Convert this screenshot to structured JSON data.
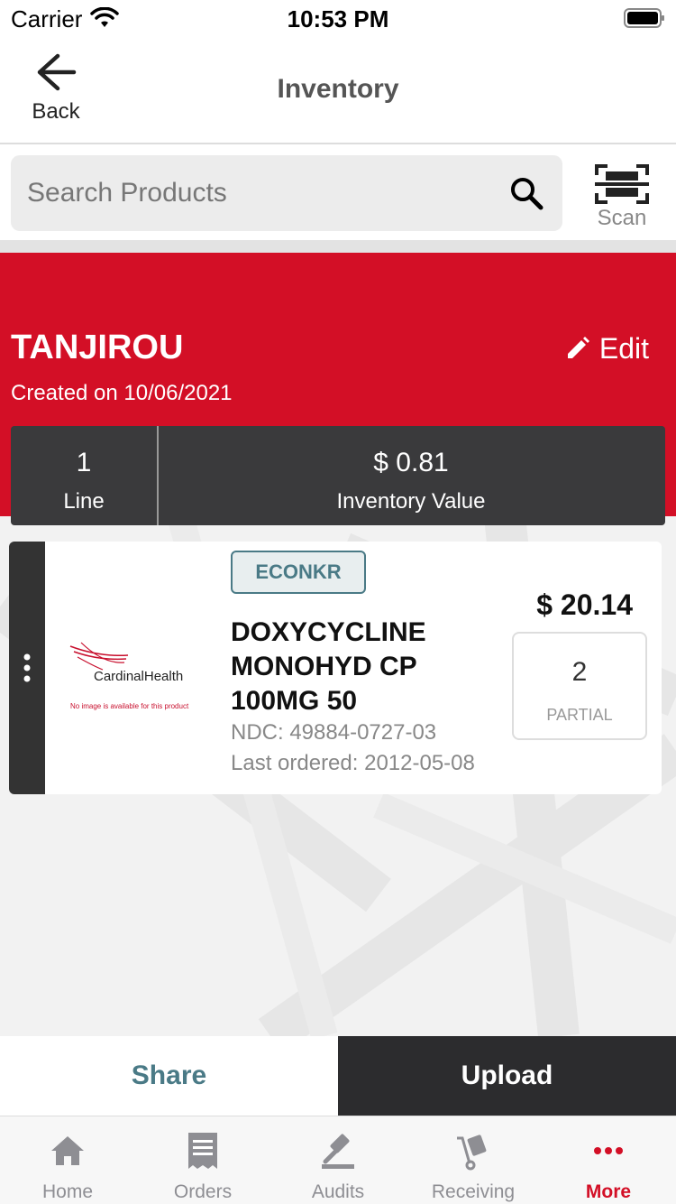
{
  "status_bar": {
    "carrier": "Carrier",
    "time": "10:53 PM"
  },
  "nav": {
    "back_label": "Back",
    "title": "Inventory"
  },
  "search": {
    "placeholder": "Search Products",
    "value": "",
    "scan_label": "Scan"
  },
  "inventory": {
    "name": "TANJIROU",
    "created": "Created on 10/06/2021",
    "edit_label": "Edit",
    "line_count": "1",
    "line_label": "Line",
    "value": "$ 0.81",
    "value_label": "Inventory Value"
  },
  "products": [
    {
      "vendor": "ECONKR",
      "logo_brand": "CardinalHealth",
      "logo_note": "No image is available for this product",
      "name": "DOXYCYCLINE MONOHYD CP 100MG 50",
      "ndc": "NDC: 49884-0727-03",
      "last_ordered": "Last ordered: 2012-05-08",
      "price": "$ 20.14",
      "quantity": "2",
      "quantity_unit": "PARTIAL"
    }
  ],
  "actions": {
    "share": "Share",
    "upload": "Upload"
  },
  "tabs": [
    {
      "label": "Home",
      "icon": "home-icon"
    },
    {
      "label": "Orders",
      "icon": "orders-icon"
    },
    {
      "label": "Audits",
      "icon": "gavel-icon"
    },
    {
      "label": "Receiving",
      "icon": "hand-truck-icon"
    },
    {
      "label": "More",
      "icon": "more-dots-icon"
    }
  ],
  "colors": {
    "accent_red": "#d30f26",
    "dark_gray": "#3a3a3c",
    "teal": "#4a7a86"
  }
}
